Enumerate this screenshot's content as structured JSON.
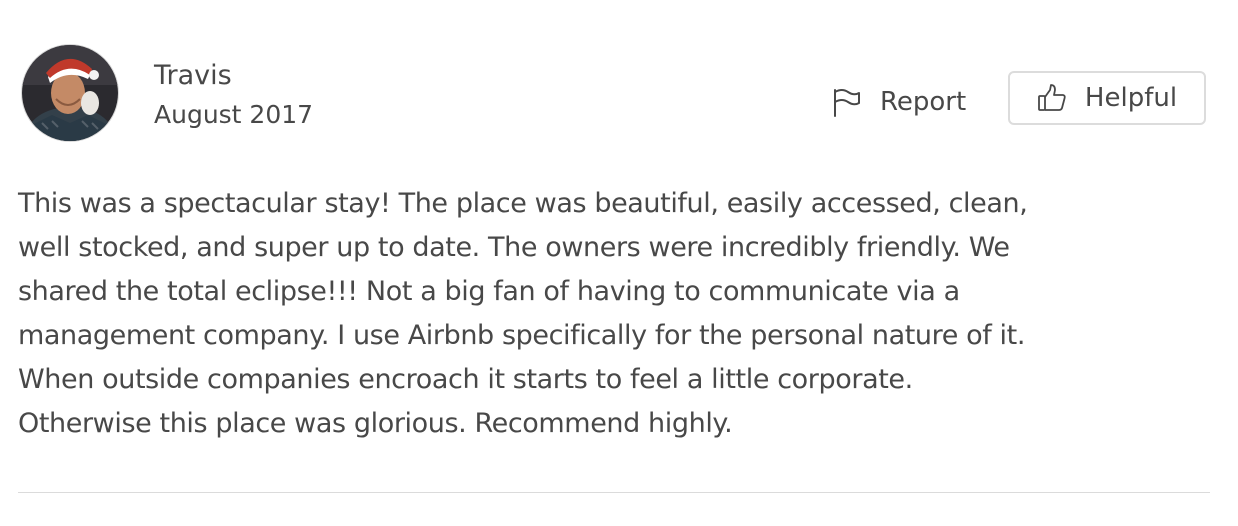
{
  "reviewer": {
    "name": "Travis",
    "date": "August 2017",
    "avatar_icon": "user-avatar-photo"
  },
  "actions": {
    "report_label": "Report",
    "report_icon": "flag-icon",
    "helpful_label": "Helpful",
    "helpful_icon": "thumbs-up-icon"
  },
  "review": {
    "lines": [
      "This was a spectacular stay! The place was beautiful, easily accessed, clean,",
      "well stocked, and super up to date. The owners were incredibly friendly. We",
      "shared the total eclipse!!! Not a big fan of having to communicate via a",
      "management company. I use Airbnb specifically for the personal nature of it.",
      "When outside companies encroach it starts to feel a little corporate.",
      "Otherwise this place was glorious. Recommend highly."
    ]
  },
  "colors": {
    "text": "#484848",
    "border": "#dcdcdc",
    "divider": "#dbdbdb"
  }
}
